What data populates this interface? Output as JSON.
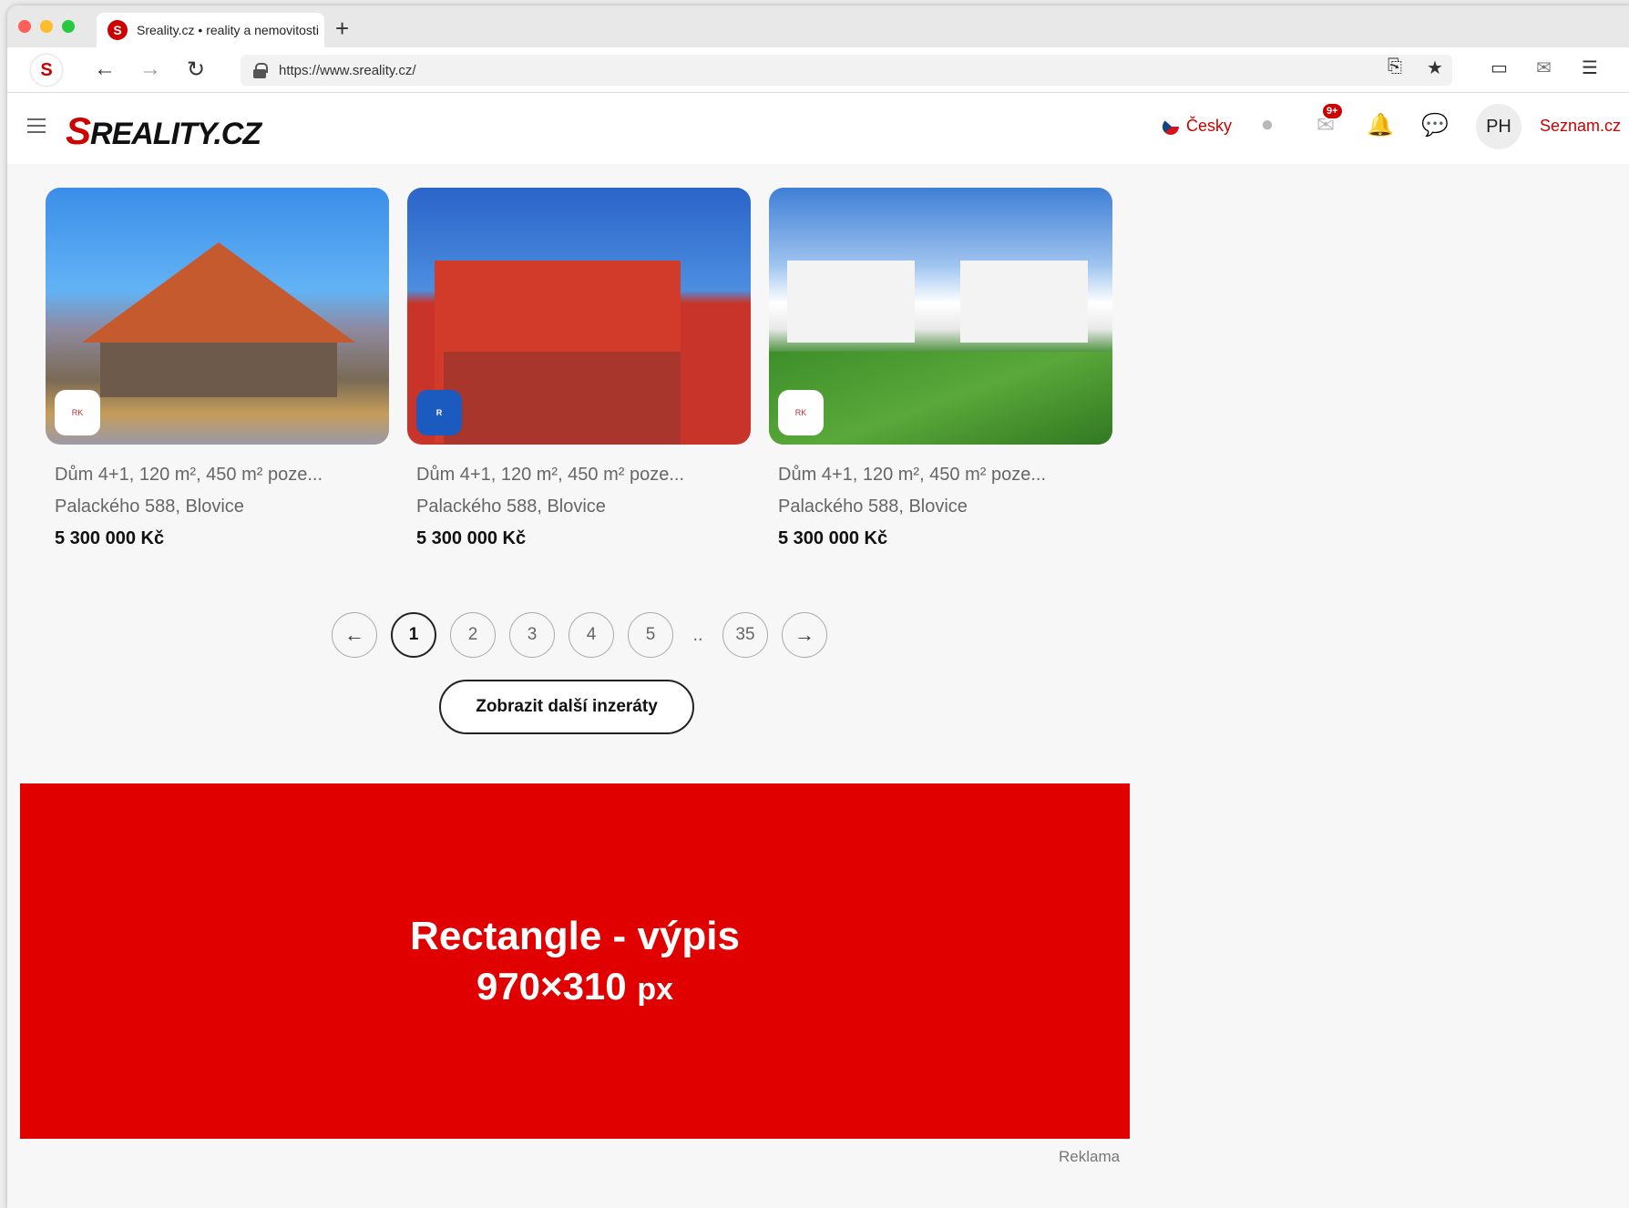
{
  "browser": {
    "tab_title": "Sreality.cz • reality a nemovitosti",
    "tab_favicon": "S",
    "new_tab": "+",
    "url": "https://www.sreality.cz/",
    "toolbar_logo": "S",
    "icons": {
      "back": "←",
      "forward": "→",
      "reload": "↻",
      "translate": "⎘",
      "star": "★",
      "sidebar": "▭",
      "mail": "✉",
      "menu": "☰"
    }
  },
  "header": {
    "logo_first": "S",
    "logo_rest": "REALITY.CZ",
    "language": "Česky",
    "mail_badge": "9+",
    "avatar_initials": "PH",
    "seznam_link": "Seznam.cz",
    "icons": {
      "chat": "●",
      "mail": "✉",
      "bell": "🔔",
      "messages": "💬"
    }
  },
  "listings": [
    {
      "title": "Dům 4+1, 120 m², 450 m² poze...",
      "address": "Palackého 588, Blovice",
      "price": "5 300 000 Kč",
      "agency_icon": "agency-logo-icon"
    },
    {
      "title": "Dům 4+1, 120 m², 450 m² poze...",
      "address": "Palackého 588, Blovice",
      "price": "5 300 000 Kč",
      "agency_icon": "remax-logo-icon"
    },
    {
      "title": "Dům 4+1, 120 m², 450 m² poze...",
      "address": "Palackého 588, Blovice",
      "price": "5 300 000 Kč",
      "agency_icon": "agency-logo-icon"
    }
  ],
  "pagination": {
    "prev": "←",
    "pages": [
      "1",
      "2",
      "3",
      "4",
      "5"
    ],
    "active": "1",
    "ellipsis": "..",
    "last": "35",
    "next": "→"
  },
  "more_button": "Zobrazit další inzeráty",
  "ad": {
    "title": "Rectangle - výpis",
    "size": "970×310",
    "unit": "px",
    "label": "Reklama",
    "color": "#e00000"
  },
  "colors": {
    "brand_red": "#cc0000",
    "text_gray": "#666666"
  }
}
